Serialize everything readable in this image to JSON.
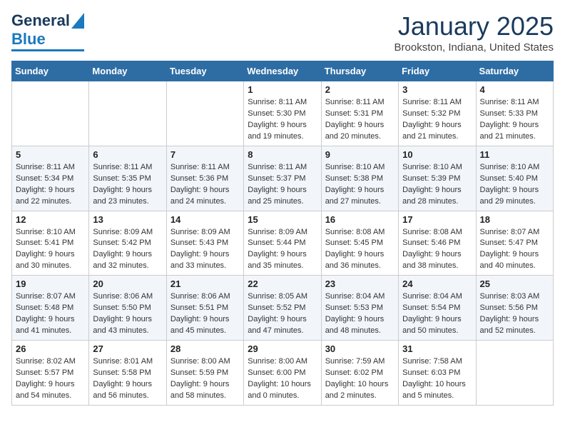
{
  "header": {
    "logo_line1": "General",
    "logo_line2": "Blue",
    "month": "January 2025",
    "location": "Brookston, Indiana, United States"
  },
  "days_of_week": [
    "Sunday",
    "Monday",
    "Tuesday",
    "Wednesday",
    "Thursday",
    "Friday",
    "Saturday"
  ],
  "weeks": [
    [
      {
        "day": "",
        "info": ""
      },
      {
        "day": "",
        "info": ""
      },
      {
        "day": "",
        "info": ""
      },
      {
        "day": "1",
        "info": "Sunrise: 8:11 AM\nSunset: 5:30 PM\nDaylight: 9 hours\nand 19 minutes."
      },
      {
        "day": "2",
        "info": "Sunrise: 8:11 AM\nSunset: 5:31 PM\nDaylight: 9 hours\nand 20 minutes."
      },
      {
        "day": "3",
        "info": "Sunrise: 8:11 AM\nSunset: 5:32 PM\nDaylight: 9 hours\nand 21 minutes."
      },
      {
        "day": "4",
        "info": "Sunrise: 8:11 AM\nSunset: 5:33 PM\nDaylight: 9 hours\nand 21 minutes."
      }
    ],
    [
      {
        "day": "5",
        "info": "Sunrise: 8:11 AM\nSunset: 5:34 PM\nDaylight: 9 hours\nand 22 minutes."
      },
      {
        "day": "6",
        "info": "Sunrise: 8:11 AM\nSunset: 5:35 PM\nDaylight: 9 hours\nand 23 minutes."
      },
      {
        "day": "7",
        "info": "Sunrise: 8:11 AM\nSunset: 5:36 PM\nDaylight: 9 hours\nand 24 minutes."
      },
      {
        "day": "8",
        "info": "Sunrise: 8:11 AM\nSunset: 5:37 PM\nDaylight: 9 hours\nand 25 minutes."
      },
      {
        "day": "9",
        "info": "Sunrise: 8:10 AM\nSunset: 5:38 PM\nDaylight: 9 hours\nand 27 minutes."
      },
      {
        "day": "10",
        "info": "Sunrise: 8:10 AM\nSunset: 5:39 PM\nDaylight: 9 hours\nand 28 minutes."
      },
      {
        "day": "11",
        "info": "Sunrise: 8:10 AM\nSunset: 5:40 PM\nDaylight: 9 hours\nand 29 minutes."
      }
    ],
    [
      {
        "day": "12",
        "info": "Sunrise: 8:10 AM\nSunset: 5:41 PM\nDaylight: 9 hours\nand 30 minutes."
      },
      {
        "day": "13",
        "info": "Sunrise: 8:09 AM\nSunset: 5:42 PM\nDaylight: 9 hours\nand 32 minutes."
      },
      {
        "day": "14",
        "info": "Sunrise: 8:09 AM\nSunset: 5:43 PM\nDaylight: 9 hours\nand 33 minutes."
      },
      {
        "day": "15",
        "info": "Sunrise: 8:09 AM\nSunset: 5:44 PM\nDaylight: 9 hours\nand 35 minutes."
      },
      {
        "day": "16",
        "info": "Sunrise: 8:08 AM\nSunset: 5:45 PM\nDaylight: 9 hours\nand 36 minutes."
      },
      {
        "day": "17",
        "info": "Sunrise: 8:08 AM\nSunset: 5:46 PM\nDaylight: 9 hours\nand 38 minutes."
      },
      {
        "day": "18",
        "info": "Sunrise: 8:07 AM\nSunset: 5:47 PM\nDaylight: 9 hours\nand 40 minutes."
      }
    ],
    [
      {
        "day": "19",
        "info": "Sunrise: 8:07 AM\nSunset: 5:48 PM\nDaylight: 9 hours\nand 41 minutes."
      },
      {
        "day": "20",
        "info": "Sunrise: 8:06 AM\nSunset: 5:50 PM\nDaylight: 9 hours\nand 43 minutes."
      },
      {
        "day": "21",
        "info": "Sunrise: 8:06 AM\nSunset: 5:51 PM\nDaylight: 9 hours\nand 45 minutes."
      },
      {
        "day": "22",
        "info": "Sunrise: 8:05 AM\nSunset: 5:52 PM\nDaylight: 9 hours\nand 47 minutes."
      },
      {
        "day": "23",
        "info": "Sunrise: 8:04 AM\nSunset: 5:53 PM\nDaylight: 9 hours\nand 48 minutes."
      },
      {
        "day": "24",
        "info": "Sunrise: 8:04 AM\nSunset: 5:54 PM\nDaylight: 9 hours\nand 50 minutes."
      },
      {
        "day": "25",
        "info": "Sunrise: 8:03 AM\nSunset: 5:56 PM\nDaylight: 9 hours\nand 52 minutes."
      }
    ],
    [
      {
        "day": "26",
        "info": "Sunrise: 8:02 AM\nSunset: 5:57 PM\nDaylight: 9 hours\nand 54 minutes."
      },
      {
        "day": "27",
        "info": "Sunrise: 8:01 AM\nSunset: 5:58 PM\nDaylight: 9 hours\nand 56 minutes."
      },
      {
        "day": "28",
        "info": "Sunrise: 8:00 AM\nSunset: 5:59 PM\nDaylight: 9 hours\nand 58 minutes."
      },
      {
        "day": "29",
        "info": "Sunrise: 8:00 AM\nSunset: 6:00 PM\nDaylight: 10 hours\nand 0 minutes."
      },
      {
        "day": "30",
        "info": "Sunrise: 7:59 AM\nSunset: 6:02 PM\nDaylight: 10 hours\nand 2 minutes."
      },
      {
        "day": "31",
        "info": "Sunrise: 7:58 AM\nSunset: 6:03 PM\nDaylight: 10 hours\nand 5 minutes."
      },
      {
        "day": "",
        "info": ""
      }
    ]
  ]
}
